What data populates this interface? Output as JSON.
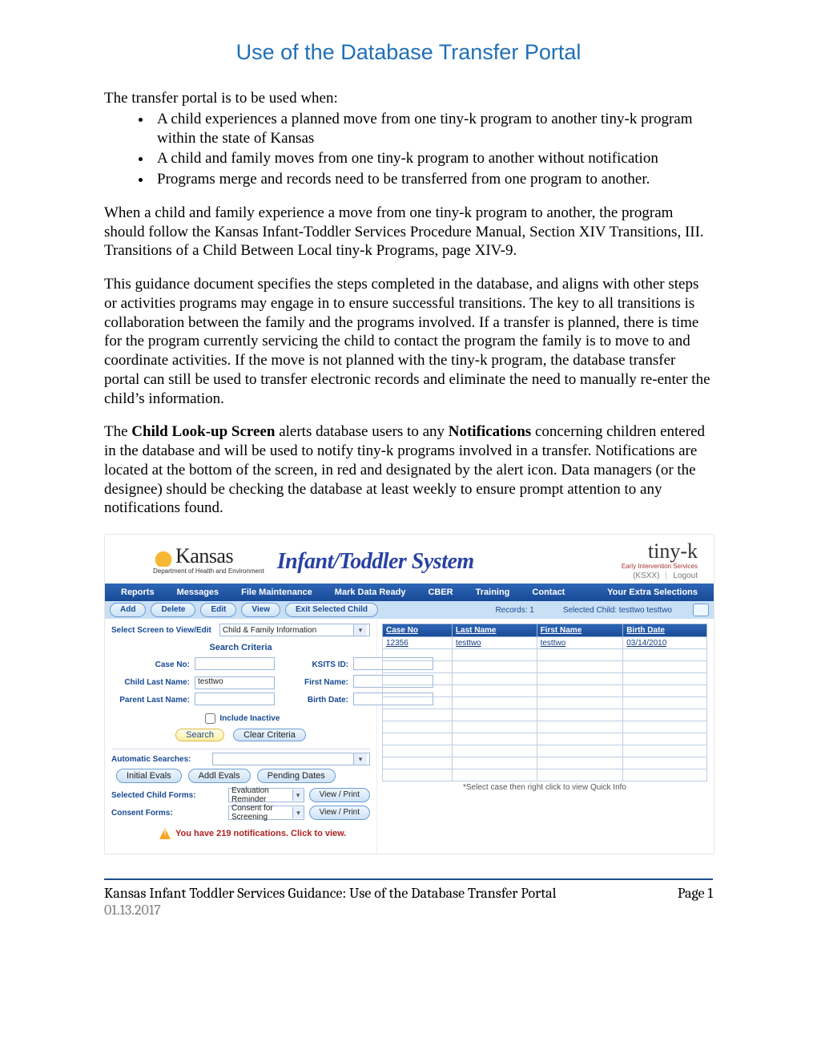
{
  "doc": {
    "title": "Use of the Database Transfer Portal",
    "intro": "The transfer portal is to be used when:",
    "bullets": [
      "A child experiences a planned move from one tiny-k program to another tiny-k program within the state of Kansas",
      "A child and family moves from one tiny-k program to another without notification",
      "Programs merge and records need to be transferred from one program to another."
    ],
    "p1": "When a child and family experience a move from one tiny-k program to another, the program should follow the Kansas Infant-Toddler Services Procedure Manual, Section XIV Transitions, III. Transitions of a Child Between Local tiny-k Programs, page XIV-9.",
    "p2": "This guidance document specifies the steps completed in the database, and aligns with other steps or activities programs may engage in to ensure successful transitions.  The key to all transitions is collaboration between the family and the programs involved. If a transfer is planned, there is time for the program currently servicing the child to contact the program the family is to move to and coordinate activities.  If the move is not planned with the tiny-k program, the database transfer portal can still be used to transfer electronic records and eliminate the need to manually re-enter the child’s information.",
    "p3a": "The ",
    "p3b": "Child Look-up Screen",
    "p3c": " alerts database users to any ",
    "p3d": "Notifications",
    "p3e": " concerning children entered in the database and will be used to notify tiny-k programs involved in a transfer. Notifications are located at the bottom of the screen, in red and designated by the alert icon. Data managers (or the designee) should be checking the database at least weekly to ensure prompt attention to any notifications found."
  },
  "footer": {
    "left": "Kansas Infant Toddler Services Guidance:  Use of the Database Transfer Portal",
    "right": "Page 1",
    "date": "01.13.2017"
  },
  "app": {
    "brand": {
      "kansas": "Kansas",
      "kansas_sub": "Department of Health\nand Environment",
      "its": "Infant/Toddler System",
      "tinyk": "tiny-k",
      "tinyk_sub": "Early Intervention Services",
      "user": "(KSXX)",
      "logout": "Logout"
    },
    "menu": [
      "Reports",
      "Messages",
      "File Maintenance",
      "Mark Data Ready",
      "CBER",
      "Training",
      "Contact",
      "Your Extra Selections"
    ],
    "toolbar": {
      "add": "Add",
      "delete": "Delete",
      "edit": "Edit",
      "view": "View",
      "exit": "Exit Selected Child",
      "records_lbl": "Records:",
      "records_val": "1",
      "selected_lbl": "Selected Child:",
      "selected_val": "testtwo testtwo"
    },
    "left": {
      "screen_lbl": "Select Screen to View/Edit",
      "screen_val": "Child & Family Information",
      "section": "Search Criteria",
      "case_no_lbl": "Case No:",
      "ksits_lbl": "KSITS ID:",
      "cln_lbl": "Child Last Name:",
      "cln_val": "testtwo",
      "fn_lbl": "First Name:",
      "pln_lbl": "Parent Last Name:",
      "bd_lbl": "Birth Date:",
      "inactive": "Include Inactive",
      "search": "Search",
      "clear": "Clear Criteria",
      "auto_lbl": "Automatic Searches:",
      "initial": "Initial Evals",
      "addl": "Addl Evals",
      "pending": "Pending Dates",
      "scf_lbl": "Selected Child Forms:",
      "scf_val": "Evaluation Reminder",
      "cf_lbl": "Consent Forms:",
      "cf_val": "Consent for Screening",
      "vp": "View / Print",
      "notif": "You have 219 notifications. Click to view."
    },
    "grid": {
      "headers": [
        "Case No",
        "Last Name",
        "First Name",
        "Birth Date"
      ],
      "row": [
        "12356",
        "testtwo",
        "testtwo",
        "03/14/2010"
      ],
      "note": "*Select case then right click to view Quick Info"
    }
  }
}
